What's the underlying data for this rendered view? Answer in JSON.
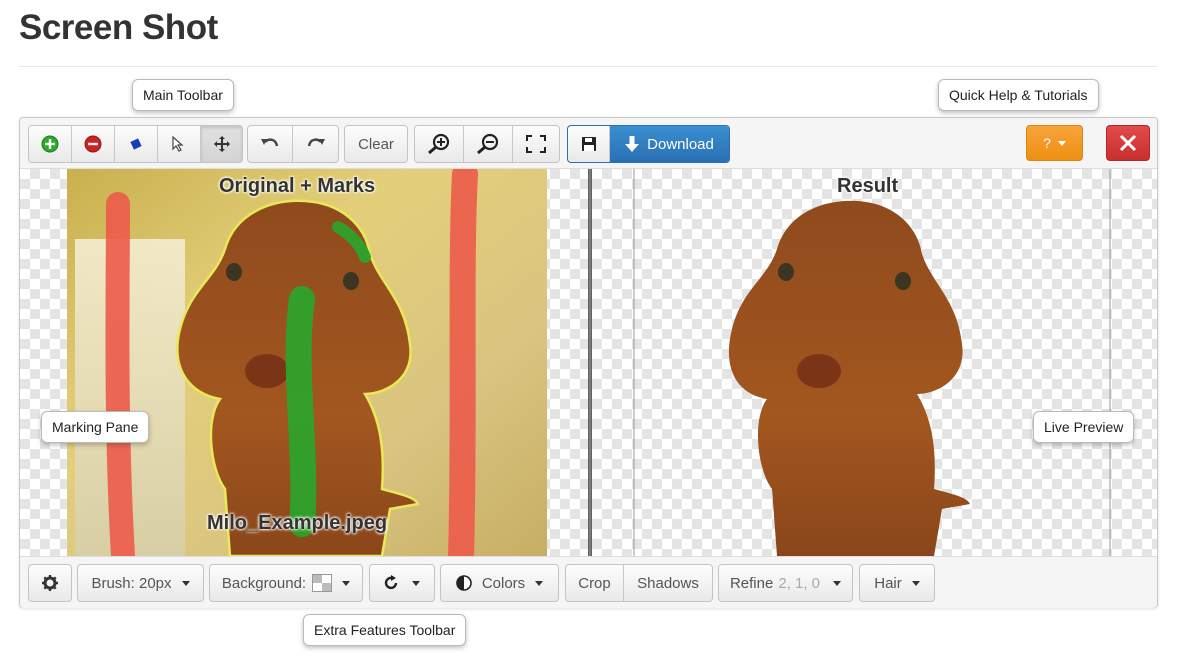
{
  "page": {
    "title": "Screen Shot"
  },
  "callouts": {
    "main_toolbar": "Main Toolbar",
    "quick_help": "Quick Help & Tutorials",
    "marking_pane": "Marking Pane",
    "live_preview": "Live Preview",
    "extra_features": "Extra Features Toolbar"
  },
  "main_toolbar": {
    "clear_label": "Clear",
    "download_label": "Download",
    "help_label": "?"
  },
  "panes": {
    "left_title": "Original + Marks",
    "file_name": "Milo_Example.jpeg",
    "right_title": "Result"
  },
  "bottom_toolbar": {
    "brush_label": "Brush: 20px",
    "background_label": "Background:",
    "colors_label": "Colors",
    "crop_label": "Crop",
    "shadows_label": "Shadows",
    "refine_label": "Refine",
    "refine_values": "2, 1, 0",
    "hair_label": "Hair"
  },
  "colors": {
    "add_green": "#2ea82e",
    "remove_red": "#cc2222",
    "download_blue": "#2f7fc4",
    "help_orange": "#f09a22",
    "close_red": "#d43c3c",
    "mark_green": "#2aa52a",
    "mark_red": "#ec5b4a"
  },
  "icons": {
    "add": "plus-circle-icon",
    "remove": "minus-circle-icon",
    "hair_brush": "diamond-icon",
    "select": "cursor-arrow-icon",
    "pan": "move-arrows-icon",
    "undo": "undo-icon",
    "redo": "redo-icon",
    "zoom_in": "zoom-in-icon",
    "zoom_out": "zoom-out-icon",
    "fit": "fit-screen-icon",
    "save": "floppy-disk-icon",
    "download": "download-arrow-icon",
    "close": "close-x-icon",
    "settings": "gear-icon",
    "rotate": "rotate-icon",
    "contrast": "contrast-icon",
    "background_swatch": "checker-swatch-icon"
  }
}
